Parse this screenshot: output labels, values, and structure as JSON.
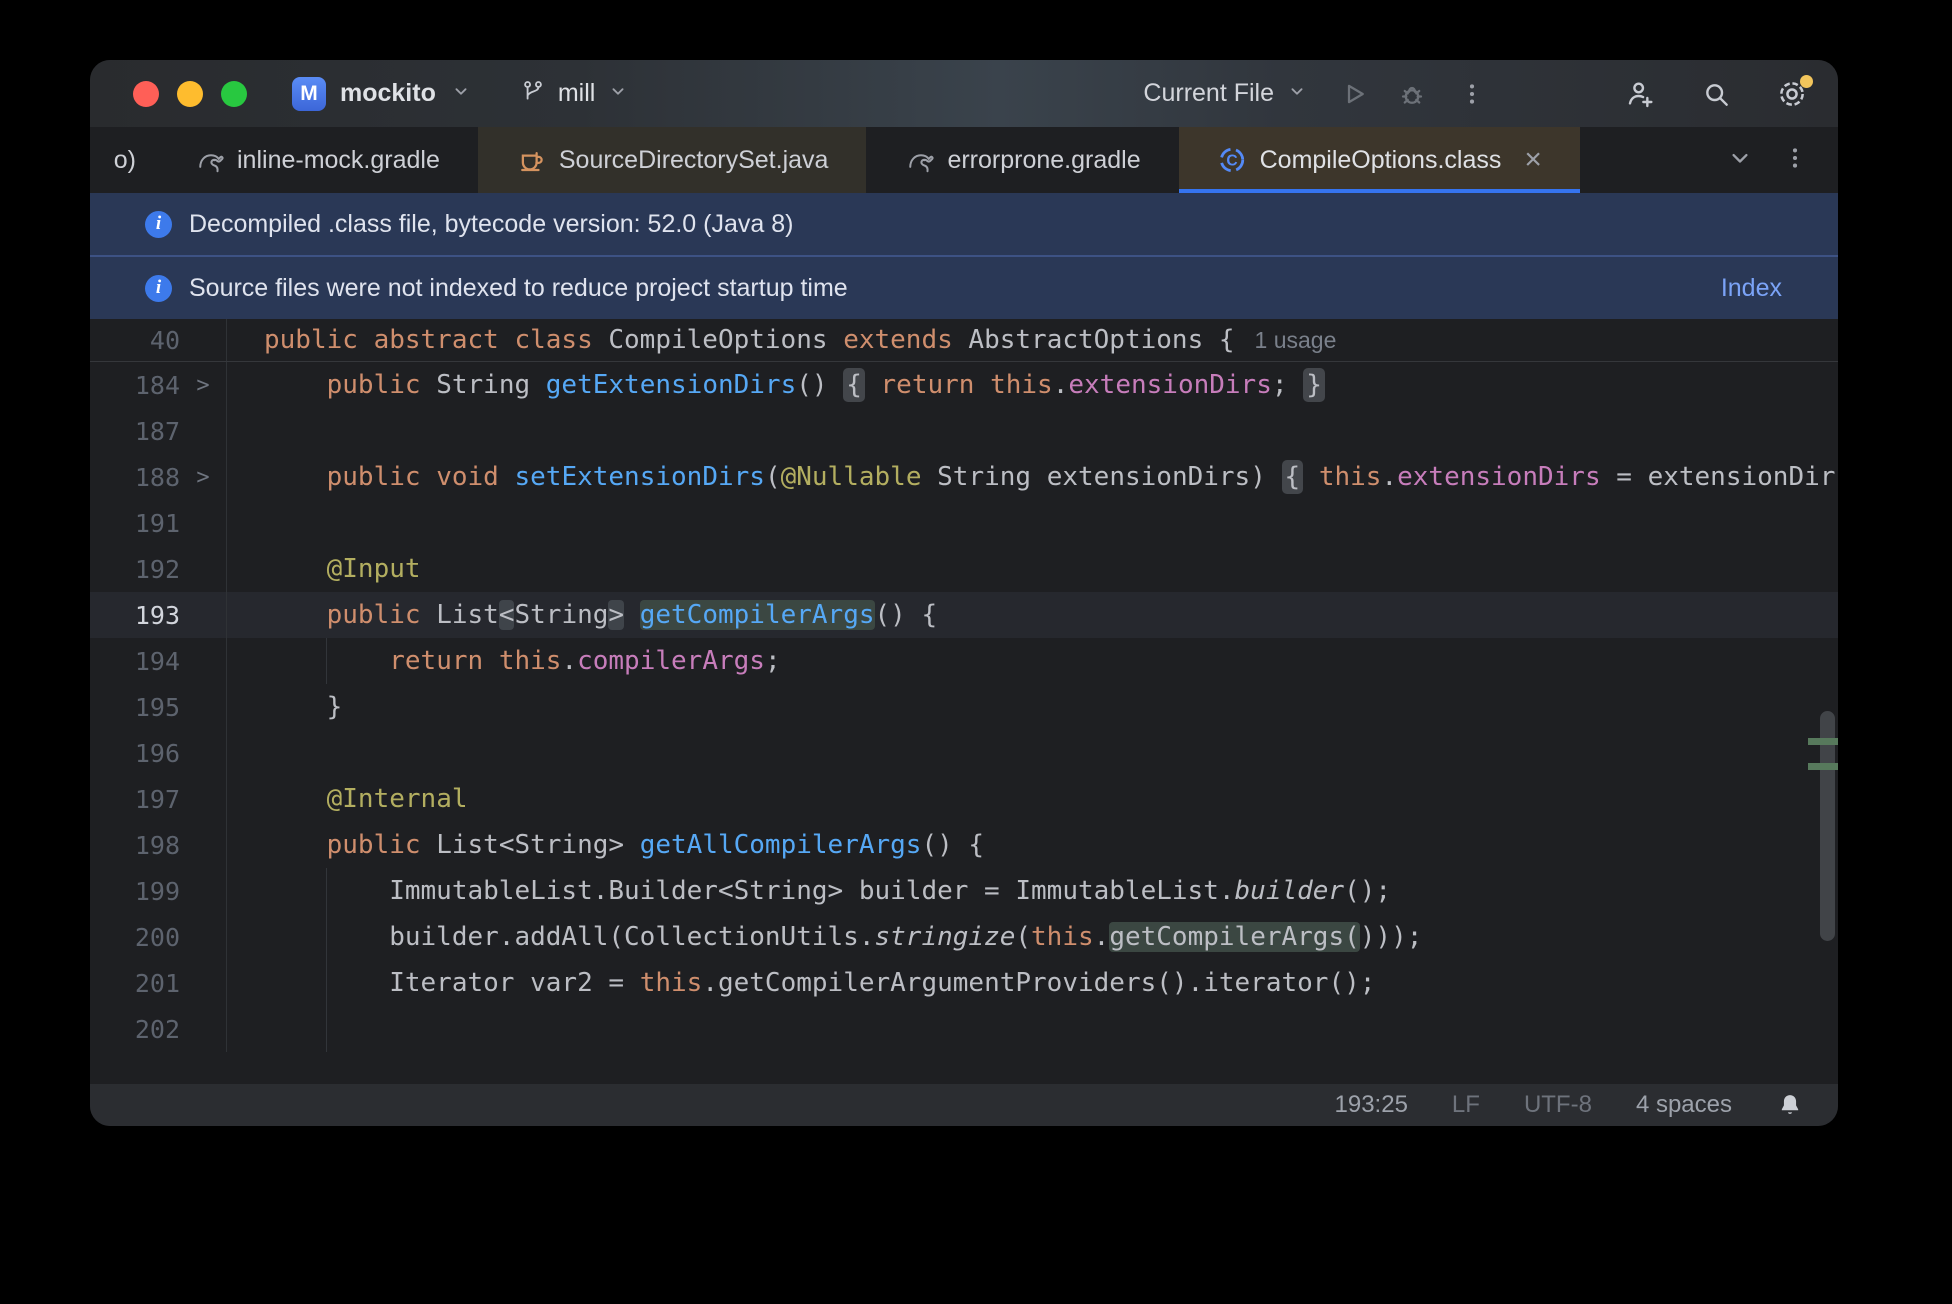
{
  "title_bar": {
    "project": "mockito",
    "project_initial": "M",
    "branch": "mill",
    "run_config": "Current File"
  },
  "tabs": [
    {
      "label": "o)",
      "partial": true
    },
    {
      "label": "inline-mock.gradle",
      "icon": "gradle"
    },
    {
      "label": "SourceDirectorySet.java",
      "icon": "java",
      "tint": true
    },
    {
      "label": "errorprone.gradle",
      "icon": "gradle"
    },
    {
      "label": "CompileOptions.class",
      "icon": "class",
      "active": true,
      "close": true
    }
  ],
  "banners": [
    {
      "text": "Decompiled .class file, bytecode version: 52.0 (Java 8)"
    },
    {
      "text": "Source files were not indexed to reduce project startup time",
      "action": "Index"
    }
  ],
  "editor": {
    "sticky": {
      "num": "40",
      "usage": "1 usage",
      "segments": [
        [
          "kw",
          "public abstract class "
        ],
        [
          "plain",
          "CompileOptions "
        ],
        [
          "kw",
          "extends "
        ],
        [
          "plain",
          "AbstractOptions {"
        ]
      ]
    },
    "lines": [
      {
        "num": "184",
        "fold": true,
        "segments": [
          [
            "plain",
            "    "
          ],
          [
            "kw",
            "public "
          ],
          [
            "plain",
            "String "
          ],
          [
            "method",
            "getExtensionDirs"
          ],
          [
            "plain",
            "() "
          ],
          [
            "box",
            "{"
          ],
          [
            "plain",
            " "
          ],
          [
            "kw",
            "return "
          ],
          [
            "kw",
            "this"
          ],
          [
            "plain",
            "."
          ],
          [
            "field",
            "extensionDirs"
          ],
          [
            "plain",
            "; "
          ],
          [
            "box",
            "}"
          ]
        ]
      },
      {
        "num": "187",
        "segments": []
      },
      {
        "num": "188",
        "fold": true,
        "segments": [
          [
            "plain",
            "    "
          ],
          [
            "kw",
            "public "
          ],
          [
            "kw",
            "void "
          ],
          [
            "method",
            "setExtensionDirs"
          ],
          [
            "plain",
            "("
          ],
          [
            "ann",
            "@Nullable"
          ],
          [
            "plain",
            " String extensionDirs) "
          ],
          [
            "box",
            "{"
          ],
          [
            "plain",
            " "
          ],
          [
            "kw",
            "this"
          ],
          [
            "plain",
            "."
          ],
          [
            "field",
            "extensionDirs"
          ],
          [
            "plain",
            " = extensionDirs"
          ]
        ]
      },
      {
        "num": "191",
        "segments": []
      },
      {
        "num": "192",
        "segments": [
          [
            "plain",
            "    "
          ],
          [
            "ann",
            "@Input"
          ]
        ]
      },
      {
        "num": "193",
        "current": true,
        "segments": [
          [
            "plain",
            "    "
          ],
          [
            "kw",
            "public "
          ],
          [
            "plain",
            "List"
          ],
          [
            "box2",
            "<"
          ],
          [
            "plain",
            "String"
          ],
          [
            "box2",
            ">"
          ],
          [
            "plain",
            " "
          ],
          [
            "mhl",
            "getCompilerArgs"
          ],
          [
            "plain",
            "() {"
          ]
        ]
      },
      {
        "num": "194",
        "segments": [
          [
            "plain",
            "        "
          ],
          [
            "kw",
            "return "
          ],
          [
            "kw",
            "this"
          ],
          [
            "plain",
            "."
          ],
          [
            "field",
            "compilerArgs"
          ],
          [
            "plain",
            ";"
          ]
        ]
      },
      {
        "num": "195",
        "segments": [
          [
            "plain",
            "    }"
          ]
        ]
      },
      {
        "num": "196",
        "segments": []
      },
      {
        "num": "197",
        "segments": [
          [
            "plain",
            "    "
          ],
          [
            "ann",
            "@Internal"
          ]
        ]
      },
      {
        "num": "198",
        "segments": [
          [
            "plain",
            "    "
          ],
          [
            "kw",
            "public "
          ],
          [
            "plain",
            "List<String> "
          ],
          [
            "method",
            "getAllCompilerArgs"
          ],
          [
            "plain",
            "() {"
          ]
        ]
      },
      {
        "num": "199",
        "segments": [
          [
            "plain",
            "        ImmutableList.Builder<String> builder = ImmutableList."
          ],
          [
            "italic",
            "builder"
          ],
          [
            "plain",
            "();"
          ]
        ]
      },
      {
        "num": "200",
        "segments": [
          [
            "plain",
            "        builder.addAll(CollectionUtils."
          ],
          [
            "italic",
            "stringize"
          ],
          [
            "plain",
            "("
          ],
          [
            "kw",
            "this"
          ],
          [
            "plain",
            "."
          ],
          [
            "phl",
            "getCompilerArgs("
          ],
          [
            "plain",
            ")));"
          ]
        ]
      },
      {
        "num": "201",
        "segments": [
          [
            "plain",
            "        Iterator var2 = "
          ],
          [
            "kw",
            "this"
          ],
          [
            "plain",
            ".getCompilerArgumentProviders().iterator();"
          ]
        ]
      },
      {
        "num": "202",
        "segments": []
      }
    ]
  },
  "status_bar": {
    "caret": "193:25",
    "line_separator": "LF",
    "encoding": "UTF-8",
    "indent": "4 spaces"
  },
  "colors": {
    "accent": "#3574f0",
    "editor_bg": "#1e1f22",
    "active_tab_bg": "#3d362b",
    "tinted_tab_bg": "#32302a",
    "banner_bg": "#2a3856",
    "banner_link": "#7ba3f7",
    "keyword": "#cf8e6d",
    "method": "#56a8f5",
    "field": "#c77dbb",
    "annotation": "#b3ae60",
    "notification_dot": "#f2c55c",
    "analyzer_mark": "#57795c"
  }
}
